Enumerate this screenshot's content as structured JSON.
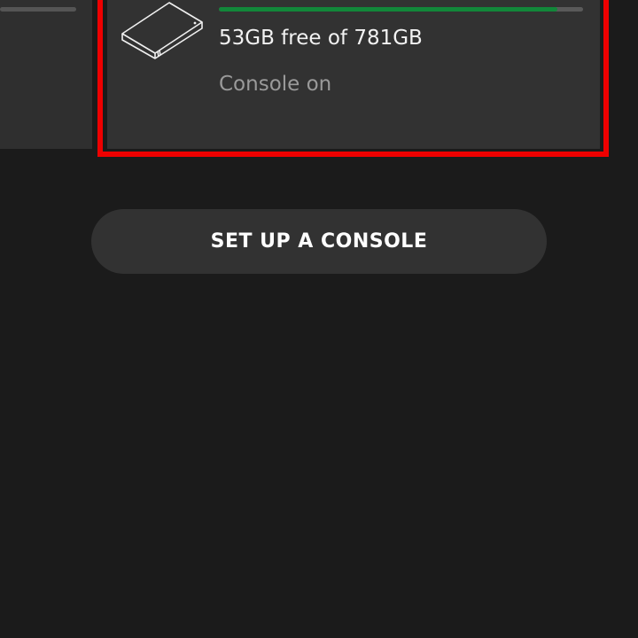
{
  "consoles": [
    {
      "partially_visible": true,
      "storage_used_fraction": null
    },
    {
      "icon": "console-hdd-icon",
      "storage_used_fraction": 0.93,
      "storage_text": "53GB free of 781GB",
      "status": "Console on",
      "highlighted": true
    }
  ],
  "setup_button": {
    "label": "SET UP A CONSOLE"
  },
  "colors": {
    "background": "#1b1b1b",
    "card": "#323232",
    "storage_fill": "#12873a",
    "highlight": "#ee0000",
    "status_text": "#9a9a9a"
  }
}
